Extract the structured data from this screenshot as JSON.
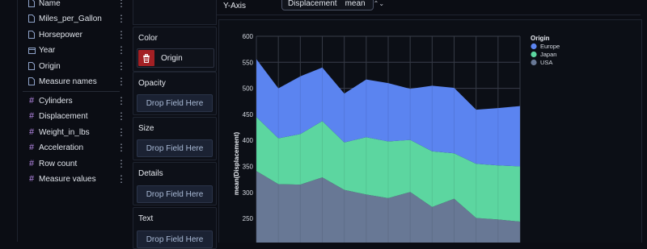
{
  "sidebar": {
    "fields": [
      {
        "name": "Name",
        "kind": "doc-icon"
      },
      {
        "name": "Miles_per_Gallon",
        "kind": "doc-icon"
      },
      {
        "name": "Horsepower",
        "kind": "doc-icon"
      },
      {
        "name": "Year",
        "kind": "calendar-icon"
      },
      {
        "name": "Origin",
        "kind": "doc-icon"
      },
      {
        "name": "Measure names",
        "kind": "doc-icon"
      }
    ],
    "measures": [
      {
        "name": "Cylinders"
      },
      {
        "name": "Displacement"
      },
      {
        "name": "Weight_in_lbs"
      },
      {
        "name": "Acceleration"
      },
      {
        "name": "Row count"
      },
      {
        "name": "Measure values"
      }
    ],
    "hash_symbol": "#",
    "kebab": "⋮"
  },
  "encodings": {
    "color": {
      "title": "Color",
      "field": "Origin"
    },
    "opacity": {
      "title": "Opacity",
      "drop": "Drop Field Here"
    },
    "size": {
      "title": "Size",
      "drop": "Drop Field Here"
    },
    "details": {
      "title": "Details",
      "drop": "Drop Field Here"
    },
    "text": {
      "title": "Text",
      "drop": "Drop Field Here"
    }
  },
  "yaxis": {
    "label": "Y-Axis",
    "field": "Displacement",
    "aggregate": "mean",
    "updown": "⌃⌄"
  },
  "colors": {
    "europe": "#5b84f0",
    "japan": "#5cd6a0",
    "usa": "#687895",
    "trash": "#a32024"
  },
  "chart_data": {
    "type": "area",
    "stacked": true,
    "ylabel": "mean(Displacement)",
    "ylim": [
      0,
      600
    ],
    "yticks": [
      600,
      550,
      500,
      450,
      400,
      350,
      300,
      250
    ],
    "x_count": 13,
    "legend": {
      "title": "Origin",
      "position": "top-right"
    },
    "series": [
      {
        "name": "USA",
        "values": [
          341,
          316,
          315,
          329,
          305,
          296,
          289,
          301,
          272,
          288,
          251,
          248,
          244
        ]
      },
      {
        "name": "Japan",
        "values": [
          104,
          88,
          97,
          108,
          91,
          110,
          109,
          100,
          107,
          87,
          104,
          104,
          106
        ]
      },
      {
        "name": "Europe",
        "values": [
          111,
          96,
          111,
          103,
          94,
          111,
          112,
          98,
          126,
          126,
          104,
          110,
          116
        ]
      }
    ],
    "grid": true
  }
}
